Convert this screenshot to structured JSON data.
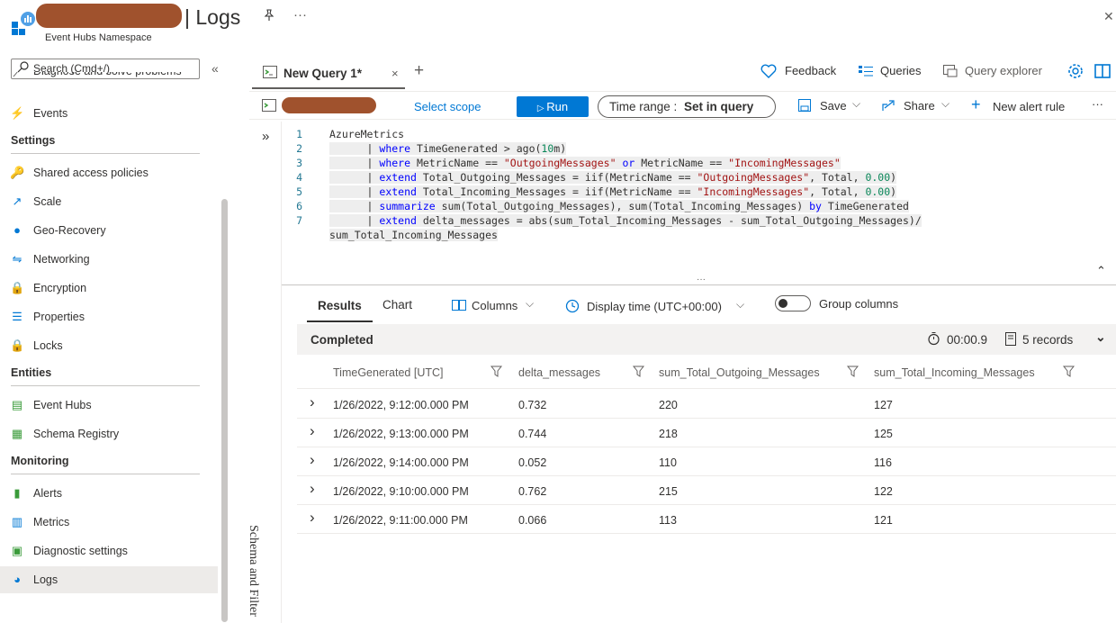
{
  "header": {
    "title": "| Logs",
    "subtitle": "Event Hubs Namespace",
    "pin_icon": "pin-icon",
    "more_label": "···",
    "close_label": "✕"
  },
  "sidebar": {
    "search_placeholder": "Search (Cmd+/)",
    "collapse_label": "«",
    "partial_item": "Diagnose and solve problems",
    "top_items": [
      {
        "label": "Events",
        "icon": "lightning-icon"
      }
    ],
    "sections": [
      {
        "title": "Settings",
        "items": [
          {
            "label": "Shared access policies",
            "icon": "key-icon"
          },
          {
            "label": "Scale",
            "icon": "scale-icon"
          },
          {
            "label": "Geo-Recovery",
            "icon": "globe-icon"
          },
          {
            "label": "Networking",
            "icon": "network-icon"
          },
          {
            "label": "Encryption",
            "icon": "lock-icon"
          },
          {
            "label": "Properties",
            "icon": "properties-icon"
          },
          {
            "label": "Locks",
            "icon": "lock-icon"
          }
        ]
      },
      {
        "title": "Entities",
        "items": [
          {
            "label": "Event Hubs",
            "icon": "event-hubs-icon"
          },
          {
            "label": "Schema Registry",
            "icon": "schema-registry-icon"
          }
        ]
      },
      {
        "title": "Monitoring",
        "items": [
          {
            "label": "Alerts",
            "icon": "alerts-icon"
          },
          {
            "label": "Metrics",
            "icon": "metrics-icon"
          },
          {
            "label": "Diagnostic settings",
            "icon": "diagnostic-icon"
          },
          {
            "label": "Logs",
            "icon": "logs-icon"
          }
        ]
      }
    ],
    "active_item": "Logs"
  },
  "tabs": {
    "query_tab": "New Query 1*",
    "close": "×",
    "add": "+",
    "feedback": "Feedback",
    "queries": "Queries",
    "query_explorer": "Query explorer"
  },
  "commands": {
    "select_scope": "Select scope",
    "run": "Run",
    "time_range_label": "Time range :",
    "time_range_value": "Set in query",
    "save": "Save",
    "share": "Share",
    "new_alert_rule": "New alert rule",
    "more": "···"
  },
  "editor": {
    "expand_label": "»",
    "side_panel_label": "Schema and Filter",
    "collapse_label": "⌃",
    "splitter_label": "···",
    "line_numbers": [
      "1",
      "2",
      "3",
      "4",
      "5",
      "6",
      "7"
    ],
    "lines": [
      [
        {
          "t": "AzureMetrics",
          "c": ""
        }
      ],
      [
        {
          "t": "      | ",
          "c": ""
        },
        {
          "t": "where",
          "c": "kw"
        },
        {
          "t": " TimeGenerated > ago(",
          "c": ""
        },
        {
          "t": "10",
          "c": "num"
        },
        {
          "t": "m)",
          "c": ""
        }
      ],
      [
        {
          "t": "      | ",
          "c": ""
        },
        {
          "t": "where",
          "c": "kw"
        },
        {
          "t": " MetricName == ",
          "c": ""
        },
        {
          "t": "\"OutgoingMessages\"",
          "c": "str"
        },
        {
          "t": " ",
          "c": ""
        },
        {
          "t": "or",
          "c": "kw"
        },
        {
          "t": " MetricName == ",
          "c": ""
        },
        {
          "t": "\"IncomingMessages\"",
          "c": "str"
        }
      ],
      [
        {
          "t": "      | ",
          "c": ""
        },
        {
          "t": "extend",
          "c": "kw"
        },
        {
          "t": " Total_Outgoing_Messages = iif(MetricName == ",
          "c": ""
        },
        {
          "t": "\"OutgoingMessages\"",
          "c": "str"
        },
        {
          "t": ", Total, ",
          "c": ""
        },
        {
          "t": "0.00",
          "c": "num"
        },
        {
          "t": ")",
          "c": ""
        }
      ],
      [
        {
          "t": "      | ",
          "c": ""
        },
        {
          "t": "extend",
          "c": "kw"
        },
        {
          "t": " Total_Incoming_Messages = iif(MetricName == ",
          "c": ""
        },
        {
          "t": "\"IncomingMessages\"",
          "c": "str"
        },
        {
          "t": ", Total, ",
          "c": ""
        },
        {
          "t": "0.00",
          "c": "num"
        },
        {
          "t": ")",
          "c": ""
        }
      ],
      [
        {
          "t": "      | ",
          "c": ""
        },
        {
          "t": "summarize",
          "c": "kw"
        },
        {
          "t": " sum(Total_Outgoing_Messages), sum(Total_Incoming_Messages) ",
          "c": ""
        },
        {
          "t": "by",
          "c": "kw"
        },
        {
          "t": " TimeGenerated",
          "c": ""
        }
      ],
      [
        {
          "t": "      | ",
          "c": ""
        },
        {
          "t": "extend",
          "c": "kw"
        },
        {
          "t": " delta_messages = abs(sum_Total_Incoming_Messages - sum_Total_Outgoing_Messages)/",
          "c": ""
        }
      ]
    ],
    "wrap_line": "sum_Total_Incoming_Messages"
  },
  "results": {
    "tab_results": "Results",
    "tab_chart": "Chart",
    "columns_btn": "Columns",
    "display_time": "Display time (UTC+00:00)",
    "group_columns": "Group columns",
    "status": "Completed",
    "duration": "00:00.9",
    "records": "5 records",
    "columns": [
      "TimeGenerated [UTC]",
      "delta_messages",
      "sum_Total_Outgoing_Messages",
      "sum_Total_Incoming_Messages"
    ],
    "rows": [
      [
        "1/26/2022, 9:12:00.000 PM",
        "0.732",
        "220",
        "127"
      ],
      [
        "1/26/2022, 9:13:00.000 PM",
        "0.744",
        "218",
        "125"
      ],
      [
        "1/26/2022, 9:14:00.000 PM",
        "0.052",
        "110",
        "116"
      ],
      [
        "1/26/2022, 9:10:00.000 PM",
        "0.762",
        "215",
        "122"
      ],
      [
        "1/26/2022, 9:11:00.000 PM",
        "0.066",
        "113",
        "121"
      ]
    ]
  },
  "colors": {
    "accent": "#0078d4",
    "redaction": "#a0522d",
    "active_bg": "#edebe9"
  }
}
